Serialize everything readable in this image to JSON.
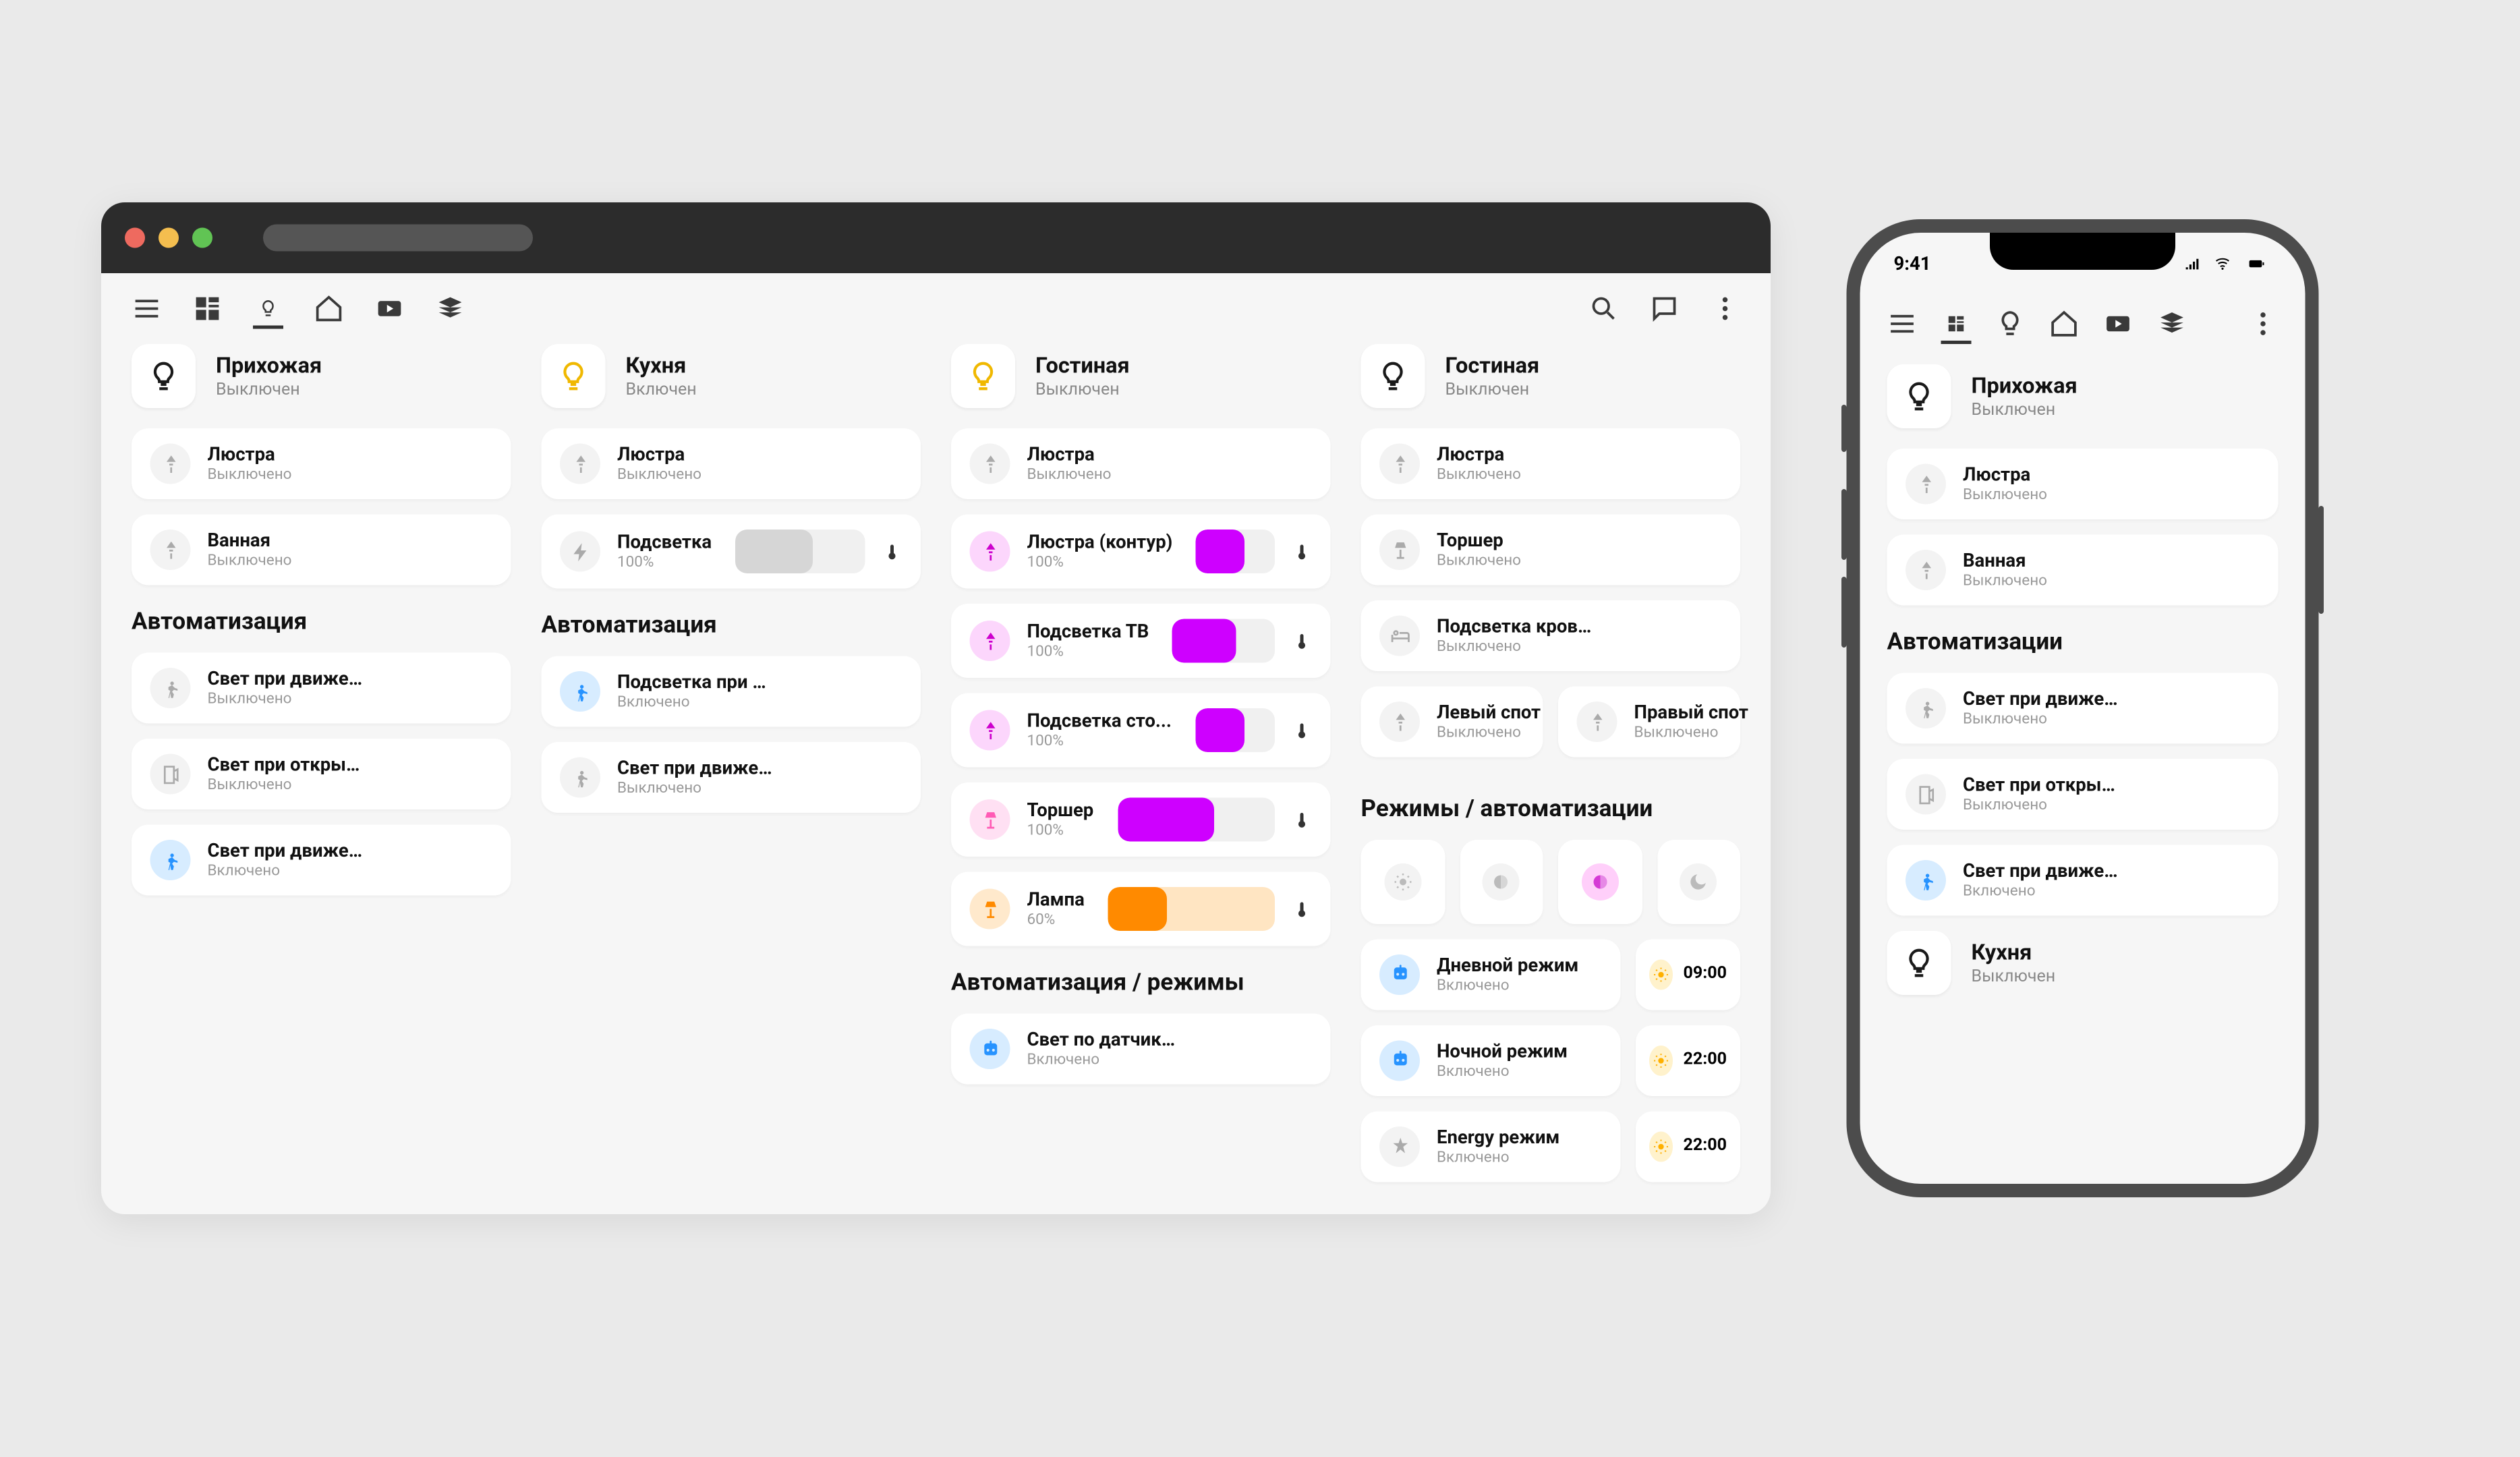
{
  "status_time": "9:41",
  "col1": {
    "room": {
      "title": "Прихожая",
      "sub": "Выключен",
      "on": false
    },
    "cards": [
      {
        "t": "Люстра",
        "s": "Выключено",
        "ic": "light"
      },
      {
        "t": "Ванная",
        "s": "Выключено",
        "ic": "light"
      }
    ],
    "section": "Автоматизация",
    "autos": [
      {
        "t": "Свет при движении",
        "s": "Выключено",
        "ic": "motion"
      },
      {
        "t": "Свет при открытии двери",
        "s": "Выключено",
        "ic": "door"
      },
      {
        "t": "Свет при движении (ванная)",
        "s": "Включено",
        "ic": "motion",
        "iccolor": "blue"
      }
    ]
  },
  "col2": {
    "room": {
      "title": "Кухня",
      "sub": "Включен",
      "on": true
    },
    "cards": [
      {
        "t": "Люстра",
        "s": "Выключено",
        "ic": "light"
      },
      {
        "t": "Подсветка",
        "s": "100%",
        "ic": "bolt",
        "slider": {
          "fill": "grey",
          "pct": 60
        },
        "temp": true
      }
    ],
    "section": "Автоматизация",
    "autos": [
      {
        "t": "Подсветка при движении",
        "s": "Включено",
        "ic": "motion",
        "iccolor": "blue"
      },
      {
        "t": "Свет при движении",
        "s": "Выключено",
        "ic": "motion"
      }
    ]
  },
  "col3": {
    "room": {
      "title": "Гостиная",
      "sub": "Выключен",
      "on": true
    },
    "cards": [
      {
        "t": "Люстра",
        "s": "Выключено",
        "ic": "light"
      },
      {
        "t": "Люстра (контур)",
        "s": "100%",
        "ic": "light",
        "iccolor": "magenta",
        "slider": {
          "fill": "magenta",
          "pct": 62
        },
        "temp": true
      },
      {
        "t": "Подсветка ТВ",
        "s": "100%",
        "ic": "light",
        "iccolor": "magenta",
        "slider": {
          "fill": "magenta",
          "pct": 62
        },
        "temp": true
      },
      {
        "t": "Подсветка сто...",
        "s": "100%",
        "ic": "light",
        "iccolor": "magenta",
        "slider": {
          "fill": "magenta",
          "pct": 62
        },
        "temp": true
      },
      {
        "t": "Торшер",
        "s": "100%",
        "ic": "lamp",
        "iccolor": "pink",
        "slider": {
          "fill": "magenta",
          "pct": 62
        },
        "temp": true
      },
      {
        "t": "Лампа",
        "s": "60%",
        "ic": "lamp",
        "iccolor": "orange",
        "slider": {
          "fill": "orange",
          "pct": 35,
          "bg": "peach"
        },
        "temp": true
      }
    ],
    "section": "Автоматизация / режимы",
    "autos": [
      {
        "t": "Свет по датчику в кресле",
        "s": "Включено",
        "ic": "robot",
        "iccolor": "blue"
      }
    ]
  },
  "col4": {
    "room": {
      "title": "Гостиная",
      "sub": "Выключен",
      "on": false
    },
    "cards": [
      {
        "t": "Люстра",
        "s": "Выключено",
        "ic": "light"
      },
      {
        "t": "Торшер",
        "s": "Выключено",
        "ic": "lamp"
      },
      {
        "t": "Подсветка кровати",
        "s": "Выключено",
        "ic": "bed"
      }
    ],
    "split": [
      {
        "t": "Левый спот",
        "s": "Выключено",
        "ic": "light"
      },
      {
        "t": "Правый спот",
        "s": "Выключено",
        "ic": "light"
      }
    ],
    "section": "Режимы / автоматизации",
    "sched": [
      {
        "t": "Дневной режим",
        "s": "Включено",
        "ic": "robot",
        "iccolor": "blue",
        "time": "09:00"
      },
      {
        "t": "Ночной режим",
        "s": "Включено",
        "ic": "robot",
        "iccolor": "blue",
        "time": "22:00"
      },
      {
        "t": "Energy режим",
        "s": "Включено",
        "ic": "energy",
        "time": "22:00"
      }
    ]
  },
  "phone": {
    "room": {
      "title": "Прихожая",
      "sub": "Выключен"
    },
    "cards": [
      {
        "t": "Люстра",
        "s": "Выключено",
        "ic": "light"
      },
      {
        "t": "Ванная",
        "s": "Выключено",
        "ic": "light"
      }
    ],
    "section": "Автоматизации",
    "autos": [
      {
        "t": "Свет при движении",
        "s": "Выключено",
        "ic": "motion"
      },
      {
        "t": "Свет при открытии двери",
        "s": "Выключено",
        "ic": "door"
      },
      {
        "t": "Свет при движении (ванная)",
        "s": "Включено",
        "ic": "motion",
        "iccolor": "blue"
      }
    ],
    "room2": {
      "title": "Кухня",
      "sub": "Выключен"
    }
  }
}
